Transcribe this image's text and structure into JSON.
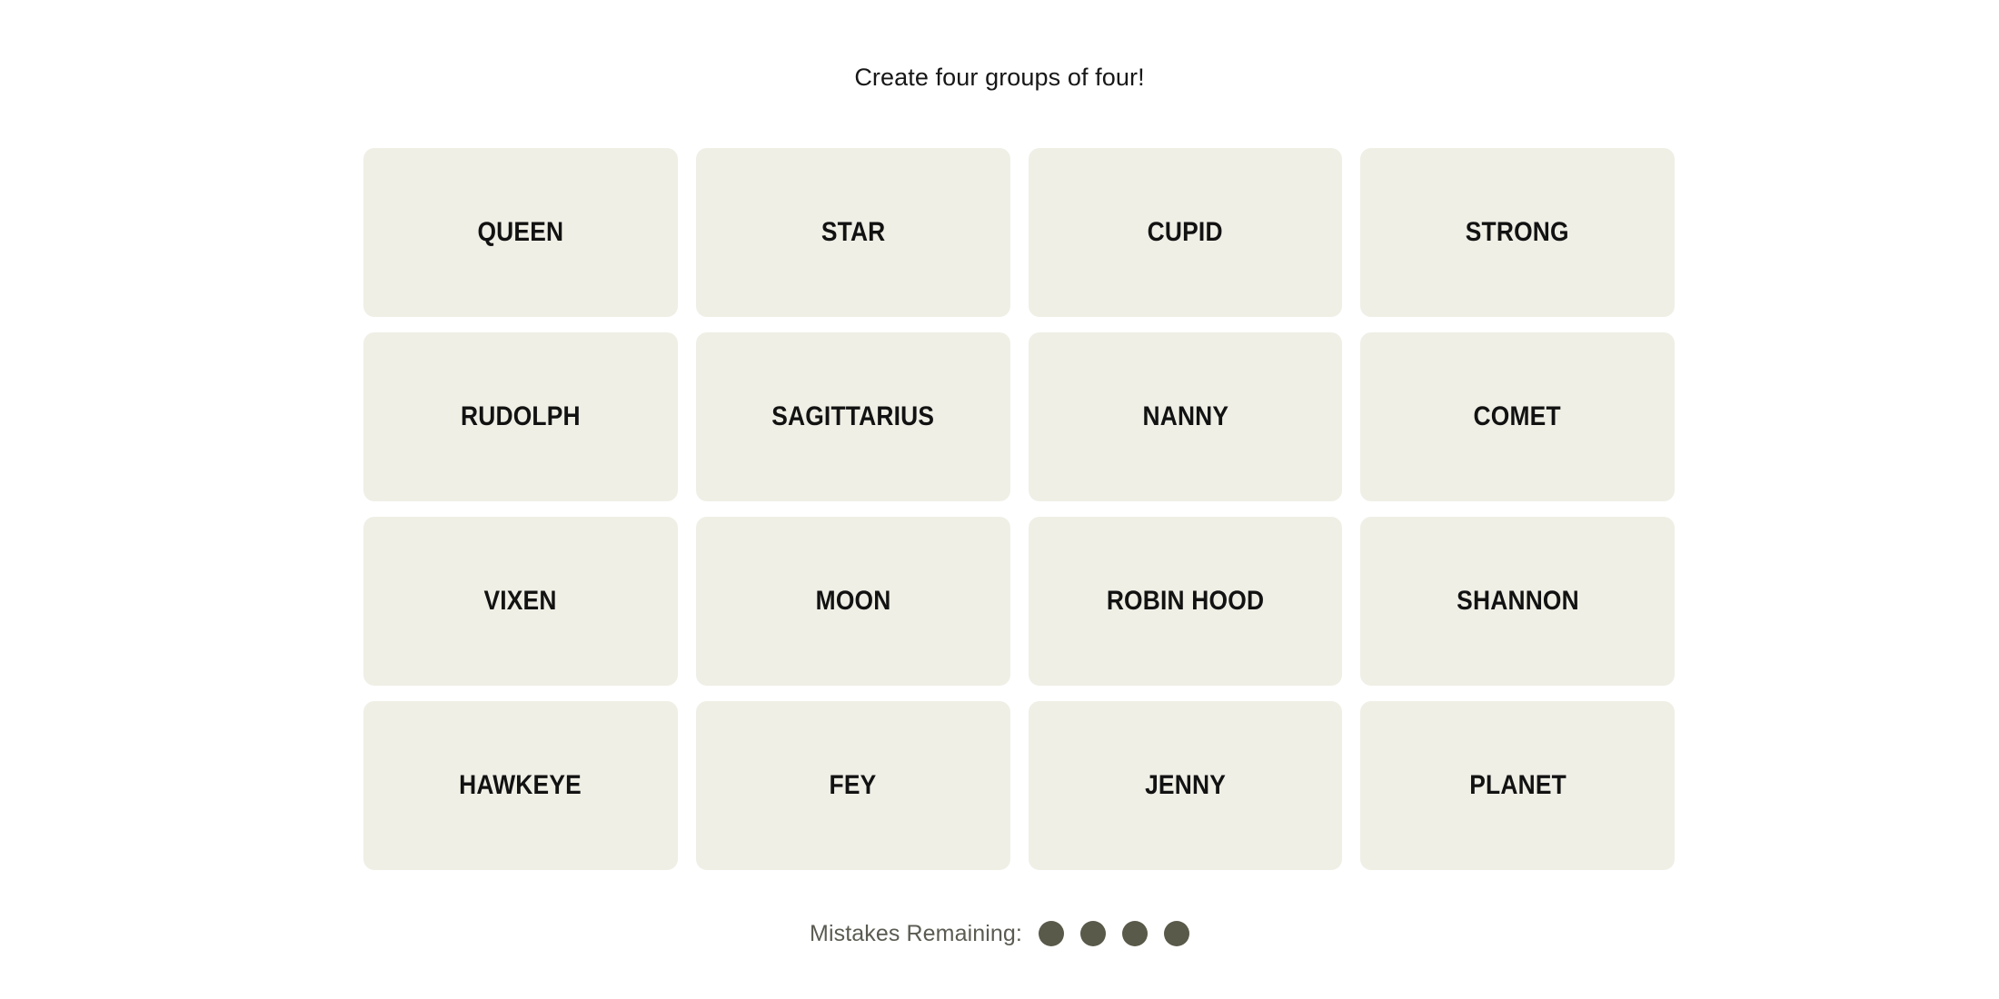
{
  "game": {
    "title": "Create four groups of four!",
    "tile_bg_color": "#EFEFE6",
    "tile_text_color": "#121212",
    "page_bg_color": "#FFFFFF",
    "title_color": "#171717"
  },
  "board": {
    "rows": 4,
    "columns": 4,
    "tiles": [
      {
        "label": "QUEEN"
      },
      {
        "label": "STAR"
      },
      {
        "label": "CUPID"
      },
      {
        "label": "STRONG"
      },
      {
        "label": "RUDOLPH"
      },
      {
        "label": "SAGITTARIUS"
      },
      {
        "label": "NANNY"
      },
      {
        "label": "COMET"
      },
      {
        "label": "VIXEN"
      },
      {
        "label": "MOON"
      },
      {
        "label": "ROBIN HOOD"
      },
      {
        "label": "SHANNON"
      },
      {
        "label": "HAWKEYE"
      },
      {
        "label": "FEY"
      },
      {
        "label": "JENNY"
      },
      {
        "label": "PLANET"
      }
    ]
  },
  "mistakes": {
    "label": "Mistakes Remaining:",
    "remaining": 4,
    "label_color": "#5B5B52",
    "dot_color": "#5A5A4B",
    "dots": [
      {
        "name": "mistake-dot-1"
      },
      {
        "name": "mistake-dot-2"
      },
      {
        "name": "mistake-dot-3"
      },
      {
        "name": "mistake-dot-4"
      }
    ]
  }
}
